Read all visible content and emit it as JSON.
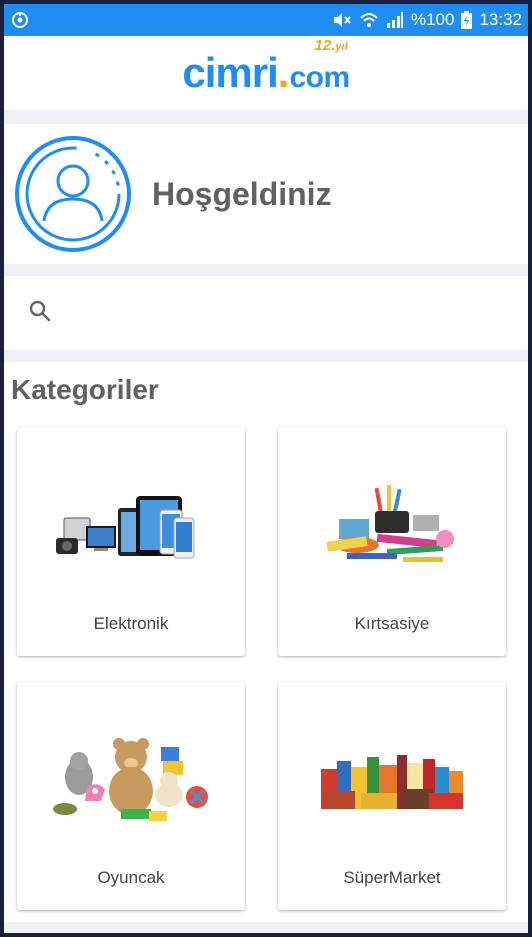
{
  "status_bar": {
    "battery": "%100",
    "time": "13:32",
    "icons": [
      "app-icon",
      "mute-icon",
      "wifi-icon",
      "signal-icon",
      "battery-icon"
    ]
  },
  "header": {
    "logo_main": "cimri",
    "logo_dot": ".",
    "logo_com": "com",
    "logo_badge_num": "12.",
    "logo_badge_text": "yıl"
  },
  "welcome": {
    "text": "Hoşgeldiniz",
    "avatar_icon": "user-avatar-icon"
  },
  "search": {
    "placeholder": "",
    "value": "",
    "icon": "search-icon"
  },
  "categories": {
    "title": "Kategoriler",
    "items": [
      {
        "label": "Elektronik"
      },
      {
        "label": "Kırtsasiye"
      },
      {
        "label": "Oyuncak"
      },
      {
        "label": "SüperMarket"
      }
    ]
  },
  "colors": {
    "accent": "#1f8df2",
    "logo_orange": "#f6a41a",
    "text_gray": "#616161",
    "background": "#eef1f5"
  }
}
